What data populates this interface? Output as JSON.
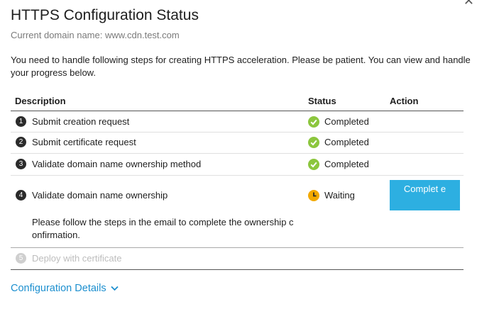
{
  "dialog": {
    "close_glyph": "✕",
    "title": "HTTPS Configuration Status",
    "domain_line": "Current domain name: www.cdn.test.com",
    "intro": "You need to handle following steps for creating HTTPS acceleration. Please be patient. You can view and handle your progress below."
  },
  "table": {
    "headers": {
      "description": "Description",
      "status": "Status",
      "action": "Action"
    },
    "steps": [
      {
        "num": "1",
        "label": "Submit creation request",
        "status": "Completed",
        "status_icon": "check-circle-icon"
      },
      {
        "num": "2",
        "label": "Submit certificate request",
        "status": "Completed",
        "status_icon": "check-circle-icon"
      },
      {
        "num": "3",
        "label": "Validate domain name ownership method",
        "status": "Completed",
        "status_icon": "check-circle-icon"
      },
      {
        "num": "4",
        "label": "Validate domain name ownership",
        "status": "Waiting",
        "status_icon": "clock-icon",
        "note": "Please follow the steps in the email to complete the ownership c onfirmation.",
        "action_label": "Complet e"
      },
      {
        "num": "5",
        "label": "Deploy with certificate",
        "status": "",
        "disabled": true
      }
    ]
  },
  "footer": {
    "details_link": "Configuration Details",
    "details_icon": "chevron-down-icon"
  },
  "colors": {
    "accent": "#2dafe1",
    "link": "#1c8fcf",
    "success": "#8cc63e",
    "waiting": "#f2a900"
  }
}
